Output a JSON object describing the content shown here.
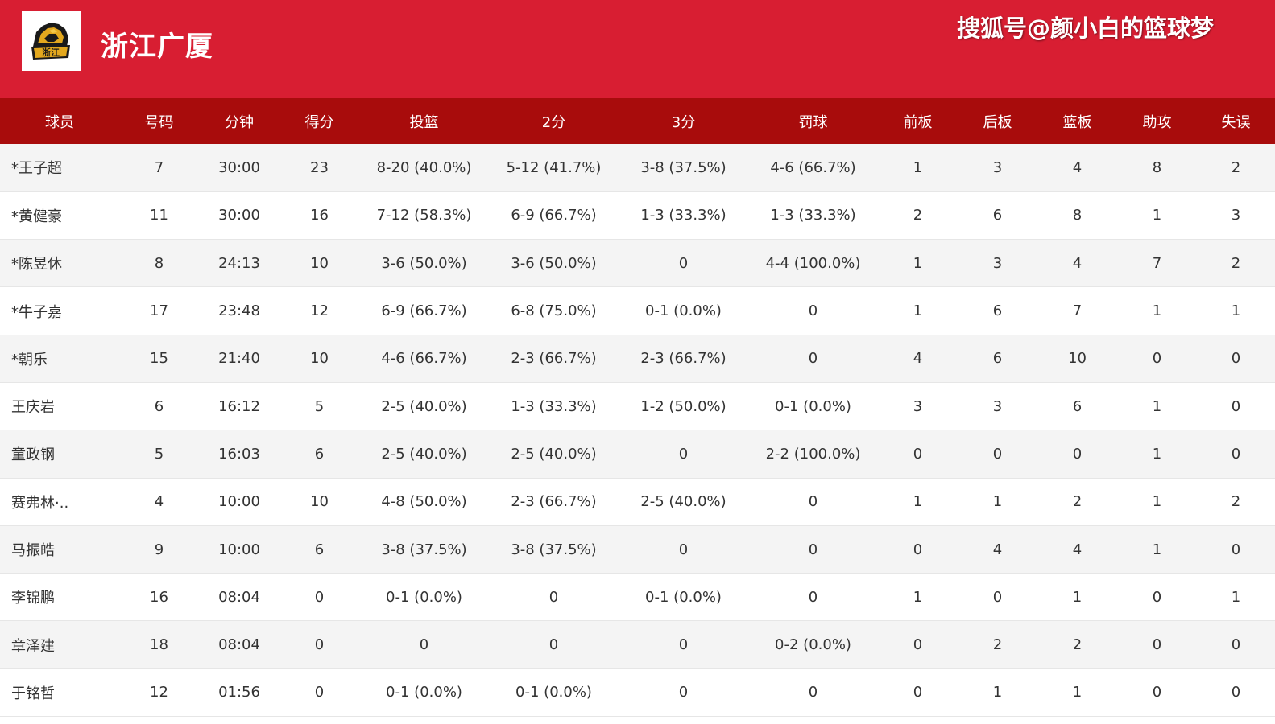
{
  "header": {
    "team_name": "浙江广厦",
    "watermark": "搜狐号@颜小白的篮球梦",
    "logo_icon": "lion-logo-icon",
    "logo_text": "浙江",
    "background_color": "#d81e32"
  },
  "table": {
    "header_color": "#a80c0c",
    "columns": [
      "球员",
      "号码",
      "分钟",
      "得分",
      "投篮",
      "2分",
      "3分",
      "罚球",
      "前板",
      "后板",
      "篮板",
      "助攻",
      "失误"
    ],
    "rows": [
      [
        "*王子超",
        "7",
        "30:00",
        "23",
        "8-20 (40.0%)",
        "5-12 (41.7%)",
        "3-8 (37.5%)",
        "4-6 (66.7%)",
        "1",
        "3",
        "4",
        "8",
        "2"
      ],
      [
        "*黄健豪",
        "11",
        "30:00",
        "16",
        "7-12 (58.3%)",
        "6-9 (66.7%)",
        "1-3 (33.3%)",
        "1-3 (33.3%)",
        "2",
        "6",
        "8",
        "1",
        "3"
      ],
      [
        "*陈昱休",
        "8",
        "24:13",
        "10",
        "3-6 (50.0%)",
        "3-6 (50.0%)",
        "0",
        "4-4 (100.0%)",
        "1",
        "3",
        "4",
        "7",
        "2"
      ],
      [
        "*牛子嘉",
        "17",
        "23:48",
        "12",
        "6-9 (66.7%)",
        "6-8 (75.0%)",
        "0-1 (0.0%)",
        "0",
        "1",
        "6",
        "7",
        "1",
        "1"
      ],
      [
        "*朝乐",
        "15",
        "21:40",
        "10",
        "4-6 (66.7%)",
        "2-3 (66.7%)",
        "2-3 (66.7%)",
        "0",
        "4",
        "6",
        "10",
        "0",
        "0"
      ],
      [
        "王庆岩",
        "6",
        "16:12",
        "5",
        "2-5 (40.0%)",
        "1-3 (33.3%)",
        "1-2 (50.0%)",
        "0-1 (0.0%)",
        "3",
        "3",
        "6",
        "1",
        "0"
      ],
      [
        "童政钢",
        "5",
        "16:03",
        "6",
        "2-5 (40.0%)",
        "2-5 (40.0%)",
        "0",
        "2-2 (100.0%)",
        "0",
        "0",
        "0",
        "1",
        "0"
      ],
      [
        "赛弗林·..",
        "4",
        "10:00",
        "10",
        "4-8 (50.0%)",
        "2-3 (66.7%)",
        "2-5 (40.0%)",
        "0",
        "1",
        "1",
        "2",
        "1",
        "2"
      ],
      [
        "马振皓",
        "9",
        "10:00",
        "6",
        "3-8 (37.5%)",
        "3-8 (37.5%)",
        "0",
        "0",
        "0",
        "4",
        "4",
        "1",
        "0"
      ],
      [
        "李锦鹏",
        "16",
        "08:04",
        "0",
        "0-1 (0.0%)",
        "0",
        "0-1 (0.0%)",
        "0",
        "1",
        "0",
        "1",
        "0",
        "1"
      ],
      [
        "章泽建",
        "18",
        "08:04",
        "0",
        "0",
        "0",
        "0",
        "0-2 (0.0%)",
        "0",
        "2",
        "2",
        "0",
        "0"
      ],
      [
        "于铭哲",
        "12",
        "01:56",
        "0",
        "0-1 (0.0%)",
        "0-1 (0.0%)",
        "0",
        "0",
        "0",
        "1",
        "1",
        "0",
        "0"
      ]
    ]
  }
}
